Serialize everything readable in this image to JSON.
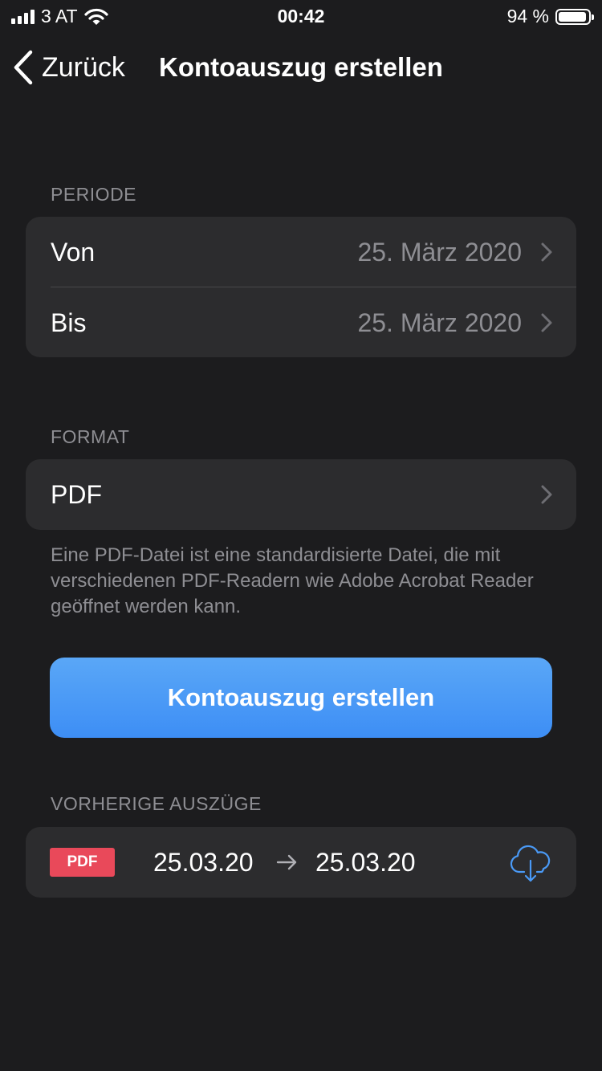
{
  "status_bar": {
    "carrier": "3 AT",
    "time": "00:42",
    "battery_percent": "94 %",
    "battery_level": 0.94,
    "signal_bars": 4
  },
  "nav": {
    "back_label": "Zurück",
    "title": "Kontoauszug erstellen"
  },
  "period": {
    "header": "PERIODE",
    "rows": [
      {
        "label": "Von",
        "value": "25. März 2020"
      },
      {
        "label": "Bis",
        "value": "25. März 2020"
      }
    ]
  },
  "format": {
    "header": "FORMAT",
    "value": "PDF",
    "footnote": "Eine PDF-Datei ist eine standardisierte Datei, die mit verschiedenen PDF-Readern wie Adobe Acrobat Reader geöffnet werden kann."
  },
  "primary_button": {
    "label": "Kontoauszug erstellen"
  },
  "history": {
    "header": "VORHERIGE AUSZÜGE",
    "items": [
      {
        "badge": "PDF",
        "from": "25.03.20",
        "to": "25.03.20"
      }
    ]
  },
  "colors": {
    "background": "#1c1c1e",
    "card": "#2c2c2e",
    "accent": "#4a9af6",
    "badge": "#e9495a",
    "secondary_text": "#8e8e93"
  },
  "icons": {
    "back": "chevron-left-icon",
    "row_disclosure": "chevron-right-icon",
    "arrow": "arrow-right-icon",
    "download": "cloud-download-icon",
    "wifi": "wifi-icon",
    "battery": "battery-icon",
    "signal": "signal-bars-icon"
  }
}
